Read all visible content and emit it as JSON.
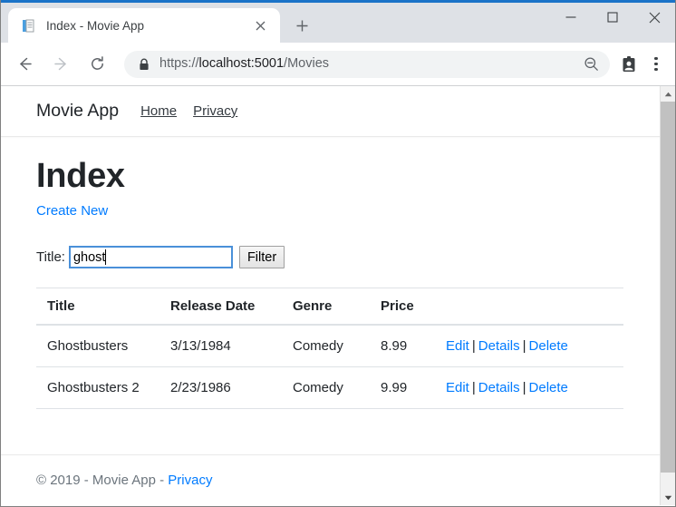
{
  "browser": {
    "tab": {
      "title": "Index - Movie App",
      "favicon_icon": "document-icon",
      "close_icon": "close-icon"
    },
    "new_tab_icon": "plus-icon",
    "window_controls": {
      "minimize_icon": "minimize-icon",
      "maximize_icon": "maximize-icon",
      "close_icon": "window-close-icon"
    },
    "toolbar": {
      "back_icon": "back-arrow-icon",
      "forward_icon": "forward-arrow-icon",
      "reload_icon": "reload-icon",
      "lock_icon": "lock-icon",
      "url_scheme": "https://",
      "url_host": "localhost:5001",
      "url_path": "/Movies",
      "zoom_out_icon": "zoom-out-icon",
      "profile_icon": "profile-badge-icon",
      "menu_icon": "three-dot-menu-icon"
    },
    "accent_color": "#1a73c8",
    "tabstrip_color": "#dee1e6"
  },
  "page": {
    "navbar": {
      "brand": "Movie App",
      "links": [
        {
          "label": "Home"
        },
        {
          "label": "Privacy"
        }
      ]
    },
    "title": "Index",
    "create_new_label": "Create New",
    "filter": {
      "label": "Title:",
      "input_value": "ghost",
      "input_placeholder": "",
      "button_label": "Filter"
    },
    "table": {
      "columns": [
        "Title",
        "Release Date",
        "Genre",
        "Price"
      ],
      "rows": [
        {
          "title": "Ghostbusters",
          "release_date": "3/13/1984",
          "genre": "Comedy",
          "price": "8.99",
          "actions": [
            "Edit",
            "Details",
            "Delete"
          ]
        },
        {
          "title": "Ghostbusters 2",
          "release_date": "2/23/1986",
          "genre": "Comedy",
          "price": "9.99",
          "actions": [
            "Edit",
            "Details",
            "Delete"
          ]
        }
      ],
      "action_separator": "|"
    },
    "footer": {
      "copyright": "© 2019 - Movie App - ",
      "privacy_label": "Privacy"
    },
    "link_color": "#007bff"
  },
  "scrollbar": {
    "up_arrow_icon": "scroll-up-arrow-icon",
    "down_arrow_icon": "scroll-down-arrow-icon"
  }
}
